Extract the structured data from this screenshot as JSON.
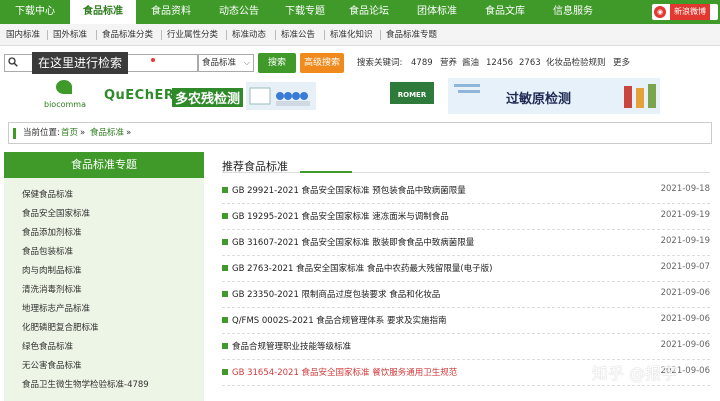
{
  "topnav": {
    "items": [
      "下载中心",
      "食品标准",
      "食品资料",
      "动态公告",
      "下载专题",
      "食品论坛",
      "团体标准",
      "食品文库",
      "信息服务"
    ],
    "active_index": 1,
    "weibo_label": "新浪微博"
  },
  "subnav": {
    "items": [
      "国内标准",
      "国外标准",
      "食品标准分类",
      "行业属性分类",
      "标准动态",
      "标准公告",
      "标准化知识",
      "食品标准专题"
    ]
  },
  "search": {
    "tooltip": "在这里进行检索",
    "select_value": "食品标准",
    "search_button": "搜索",
    "advanced_button": "高级搜索",
    "keywords_label": "搜索关键词:",
    "keywords": [
      "4789",
      "营养",
      "酱油",
      "12456",
      "2763",
      "化妆品检验规则",
      "更多"
    ]
  },
  "banners": {
    "left_logo": "biocomma",
    "left_title": "QuEChERS",
    "left_title2": "多农残检测",
    "right_logo": "ROMER",
    "right_title": "过敏原检测"
  },
  "breadcrumb": {
    "prefix": "当前位置:",
    "home": "首页",
    "sep1": "»",
    "section": "食品标准",
    "sep2": "»"
  },
  "sidebar": {
    "title": "食品标准专题",
    "items": [
      "保健食品标准",
      "食品安全国家标准",
      "食品添加剂标准",
      "食品包装标准",
      "肉与肉制品标准",
      "清洗消毒剂标准",
      "地理标志产品标准",
      "化肥磷肥复合肥标准",
      "绿色食品标准",
      "无公害食品标准",
      "食品卫生微生物学检验标准-4789"
    ]
  },
  "main": {
    "title": "推荐食品标准",
    "rows": [
      {
        "text": "GB 29921-2021 食品安全国家标准 预包装食品中致病菌限量",
        "date": "2021-09-18"
      },
      {
        "text": "GB 19295-2021 食品安全国家标准 速冻面米与调制食品",
        "date": "2021-09-19"
      },
      {
        "text": "GB 31607-2021 食品安全国家标准 散装即食食品中致病菌限量",
        "date": "2021-09-19"
      },
      {
        "text": "GB 2763-2021 食品安全国家标准 食品中农药最大残留限量(电子版)",
        "date": "2021-09-07"
      },
      {
        "text": "GB 23350-2021 限制商品过度包装要求 食品和化妆品",
        "date": "2021-09-06"
      },
      {
        "text": "Q/FMS 0002S-2021 食品合规管理体系 要求及实施指南",
        "date": "2021-09-06"
      },
      {
        "text": "食品合规管理职业技能等级标准",
        "date": "2021-09-06"
      },
      {
        "text": "GB 31654-2021 食品安全国家标准 餐饮服务通用卫生规范",
        "date": "2021-09-06"
      }
    ]
  },
  "watermark": "知乎 @报宇"
}
